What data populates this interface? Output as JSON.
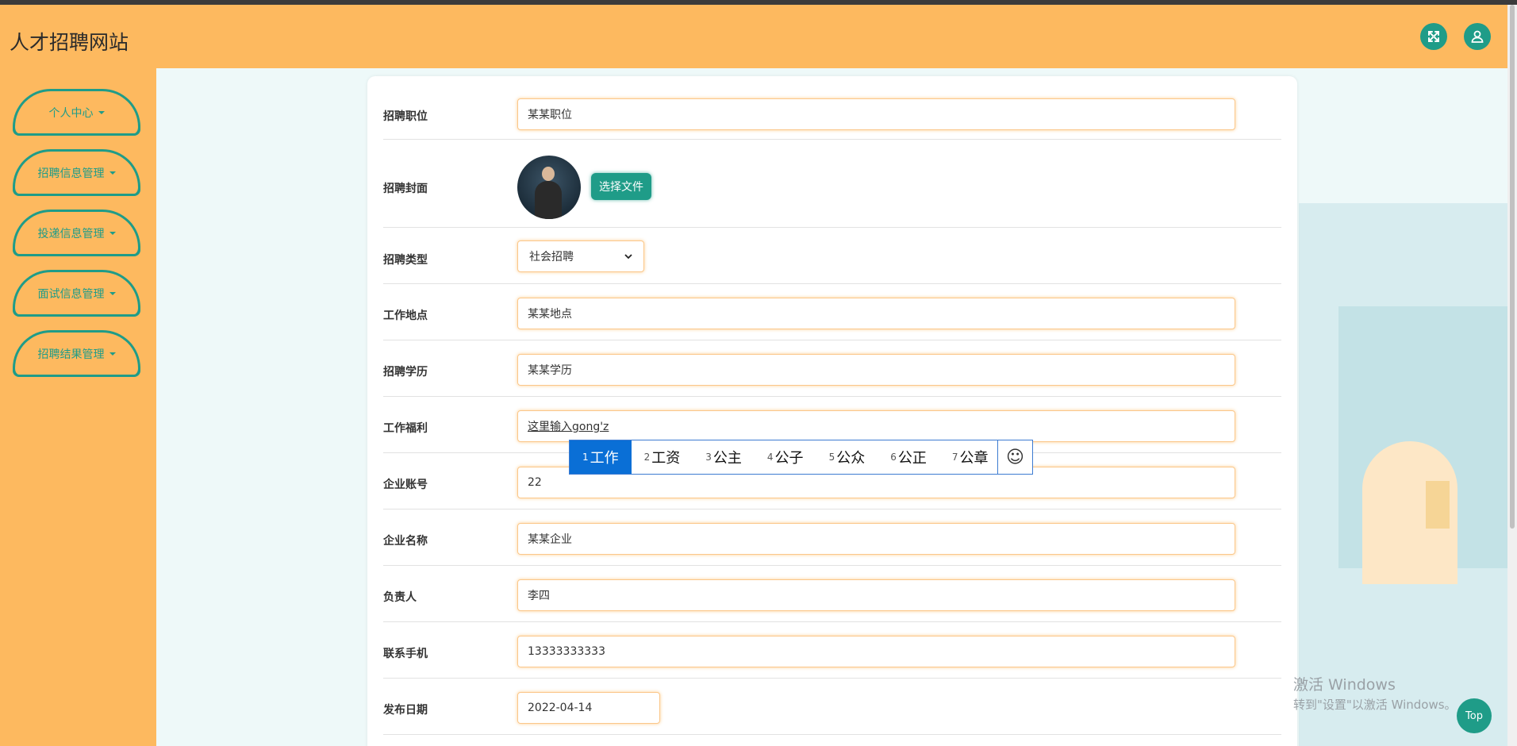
{
  "header": {
    "title": "人才招聘网站"
  },
  "sidebar": {
    "items": [
      {
        "label": "个人中心"
      },
      {
        "label": "招聘信息管理"
      },
      {
        "label": "投递信息管理"
      },
      {
        "label": "面试信息管理"
      },
      {
        "label": "招聘结果管理"
      }
    ]
  },
  "form": {
    "position": {
      "label": "招聘职位",
      "value": "某某职位"
    },
    "cover": {
      "label": "招聘封面",
      "button": "选择文件"
    },
    "type": {
      "label": "招聘类型",
      "value": "社会招聘"
    },
    "location": {
      "label": "工作地点",
      "value": "某某地点"
    },
    "education": {
      "label": "招聘学历",
      "value": "某某学历"
    },
    "welfare": {
      "label": "工作福利",
      "value": "这里输入gong'z"
    },
    "account": {
      "label": "企业账号",
      "value": "22"
    },
    "company": {
      "label": "企业名称",
      "value": "某某企业"
    },
    "manager": {
      "label": "负责人",
      "value": "李四"
    },
    "phone": {
      "label": "联系手机",
      "value": "13333333333"
    },
    "date": {
      "label": "发布日期",
      "value": "2022-04-14"
    }
  },
  "ime": {
    "candidates": [
      {
        "num": "1",
        "text": "工作"
      },
      {
        "num": "2",
        "text": "工资"
      },
      {
        "num": "3",
        "text": "公主"
      },
      {
        "num": "4",
        "text": "公子"
      },
      {
        "num": "5",
        "text": "公众"
      },
      {
        "num": "6",
        "text": "公正"
      },
      {
        "num": "7",
        "text": "公章"
      }
    ],
    "emoji": "☺"
  },
  "activation": {
    "line1": "激活 Windows",
    "line2": "转到\"设置\"以激活 Windows。"
  },
  "top_button": "Top",
  "colors": {
    "primary": "#1f9c88",
    "header_bg": "#fdb95f",
    "ime_active": "#0a6fd6"
  }
}
